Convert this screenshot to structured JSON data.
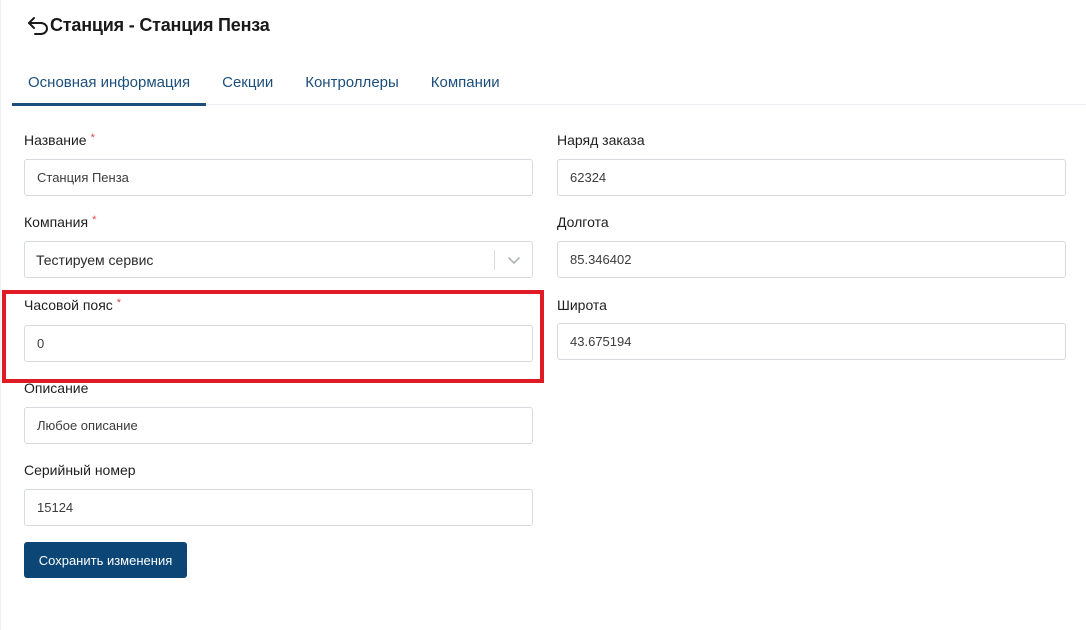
{
  "header": {
    "title": "Станция - Станция Пенза",
    "back_icon": "back-arrow-icon"
  },
  "tabs": [
    {
      "label": "Основная информация",
      "active": true
    },
    {
      "label": "Секции",
      "active": false
    },
    {
      "label": "Контроллеры",
      "active": false
    },
    {
      "label": "Компании",
      "active": false
    }
  ],
  "form": {
    "name": {
      "label": "Название",
      "required": "*",
      "value": "Станция Пенза"
    },
    "company": {
      "label": "Компания",
      "required": "*",
      "value": "Тестируем сервис"
    },
    "timezone": {
      "label": "Часовой пояс",
      "required": "*",
      "value": "0"
    },
    "description": {
      "label": "Описание",
      "value": "Любое описание"
    },
    "serial": {
      "label": "Серийный номер",
      "value": "15124"
    },
    "order": {
      "label": "Наряд заказа",
      "value": "62324"
    },
    "longitude": {
      "label": "Долгота",
      "value": "85.346402"
    },
    "latitude": {
      "label": "Широта",
      "value": "43.675194"
    }
  },
  "actions": {
    "save_label": "Сохранить изменения"
  },
  "colors": {
    "accent": "#1d4f7c",
    "button": "#0b4677",
    "required": "#e04848",
    "highlight": "#e01b24"
  }
}
